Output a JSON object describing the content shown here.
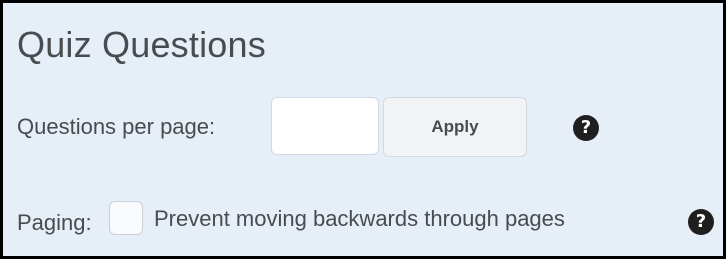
{
  "section": {
    "title": "Quiz Questions"
  },
  "questions_per_page": {
    "label": "Questions per page:",
    "value": "",
    "placeholder": "",
    "apply_label": "Apply",
    "help_glyph": "?"
  },
  "paging": {
    "label": "Paging:",
    "checkbox_checked": false,
    "checkbox_label": "Prevent moving backwards through pages",
    "help_glyph": "?"
  },
  "colors": {
    "panel_background": "#e6eff7",
    "text": "#494c4e",
    "border": "#000000",
    "help_icon": "#1f1f1f"
  },
  "icons": {
    "help": "help-icon"
  }
}
